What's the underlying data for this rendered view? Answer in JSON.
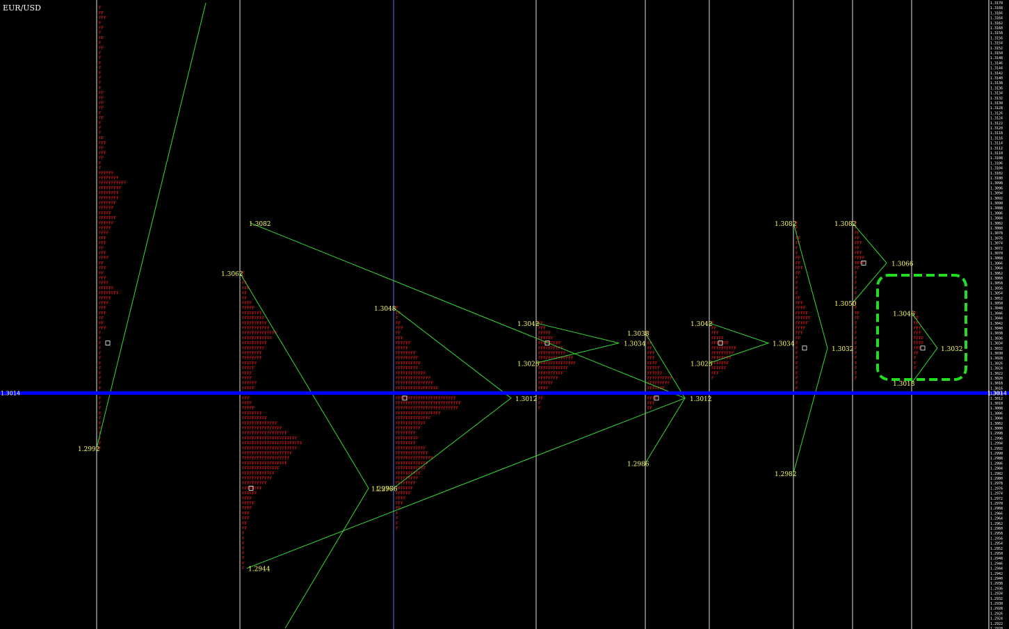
{
  "window": {
    "symbol": "EUR/USD"
  },
  "colors": {
    "background": "#000000",
    "tpo": "#ff2020",
    "wave": "#33dd33",
    "label": "#ffff66",
    "session_line": "#e0e0e0",
    "current_price_line": "#0000ff",
    "highlight": "#22dd22"
  },
  "chart_data": {
    "type": "market_profile",
    "instrument": "EUR/USD",
    "ylim": [
      1.292,
      1.317
    ],
    "current_price": "1.3014",
    "tick_step": 0.0002,
    "sessions": [
      {
        "high": 1.3168,
        "low": 1.2992,
        "poc": 1.3034,
        "labels": [
          {
            "price": "1.2992",
            "side": "left"
          }
        ]
      },
      {
        "high": 1.3062,
        "low": 1.2944,
        "poc": 1.2976,
        "labels": [
          {
            "price": "1.3082",
            "side": "right"
          },
          {
            "price": "1.3062",
            "side": "left"
          },
          {
            "price": "1.2976",
            "side": "right"
          },
          {
            "price": "1.2976",
            "side": "right"
          },
          {
            "price": "1.2944",
            "side": "right"
          }
        ]
      },
      {
        "high": 1.3048,
        "low": 1.296,
        "poc": 1.3012,
        "labels": [
          {
            "price": "1.3048",
            "side": "left"
          },
          {
            "price": "1.3012",
            "side": "right"
          }
        ]
      },
      {
        "high": 1.3042,
        "low": 1.3008,
        "poc": 1.3034,
        "labels": [
          {
            "price": "1.3042",
            "side": "left"
          },
          {
            "price": "1.3026",
            "side": "left"
          },
          {
            "price": "1.3034",
            "side": "right"
          }
        ]
      },
      {
        "high": 1.3038,
        "low": 1.3008,
        "poc": 1.3012,
        "labels": [
          {
            "price": "1.3038",
            "side": "left"
          },
          {
            "price": "1.2986",
            "side": "left"
          },
          {
            "price": "1.3012",
            "side": "right"
          }
        ]
      },
      {
        "high": 1.3042,
        "low": 1.302,
        "poc": 1.3034,
        "labels": [
          {
            "price": "1.3042",
            "side": "left"
          },
          {
            "price": "1.3026",
            "side": "left"
          },
          {
            "price": "1.3034",
            "side": "right"
          }
        ]
      },
      {
        "high": 1.3082,
        "low": 1.3016,
        "poc": 1.3032,
        "labels": [
          {
            "price": "1.3082",
            "side": "left"
          },
          {
            "price": "1.3032",
            "side": "right"
          },
          {
            "price": "1.2982",
            "side": "left"
          }
        ]
      },
      {
        "high": 1.3082,
        "low": 1.302,
        "poc": 1.3066,
        "labels": [
          {
            "price": "1.3082",
            "side": "left"
          },
          {
            "price": "1.3050",
            "side": "left"
          },
          {
            "price": "1.3066",
            "side": "right"
          }
        ]
      },
      {
        "high": 1.3046,
        "low": 1.3024,
        "poc": 1.3032,
        "labels": [
          {
            "price": "1.3046",
            "side": "left"
          },
          {
            "price": "1.3032",
            "side": "right"
          },
          {
            "price": "1.3018",
            "side": "left"
          }
        ]
      }
    ]
  }
}
